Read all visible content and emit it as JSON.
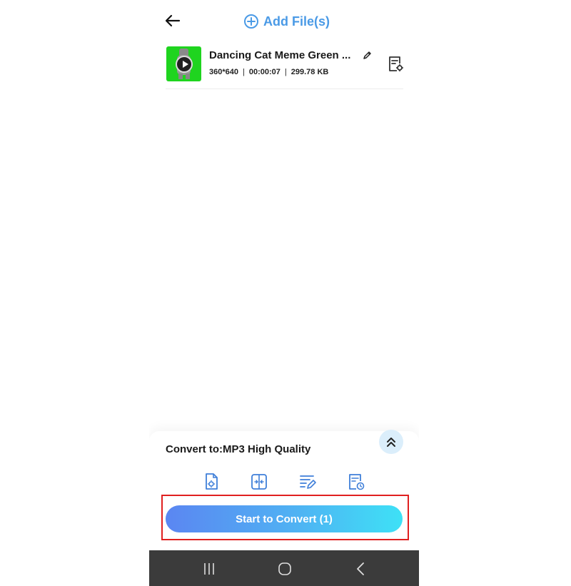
{
  "header": {
    "add_files_label": "Add File(s)"
  },
  "file": {
    "name": "Dancing Cat Meme  Green ...",
    "resolution": "360*640",
    "duration": "00:00:07",
    "size": "299.78 KB",
    "separator": "|"
  },
  "panel": {
    "convert_label": "Convert to:MP3 High Quality",
    "start_button_label": "Start to Convert (1)"
  },
  "colors": {
    "accent": "#4a9ae6",
    "thumbnail_bg": "#1fd41f",
    "highlight": "#e02020",
    "navbar": "#3b3b3b"
  },
  "icons": {
    "back": "arrow-left-icon",
    "add": "plus-circle-icon",
    "edit": "pencil-icon",
    "settings": "file-settings-icon",
    "expand": "double-chevron-up-icon",
    "tools": [
      "file-settings-icon",
      "trim-icon",
      "edit-list-icon",
      "file-schedule-icon"
    ],
    "nav": [
      "recents-icon",
      "home-icon",
      "nav-back-icon"
    ]
  }
}
